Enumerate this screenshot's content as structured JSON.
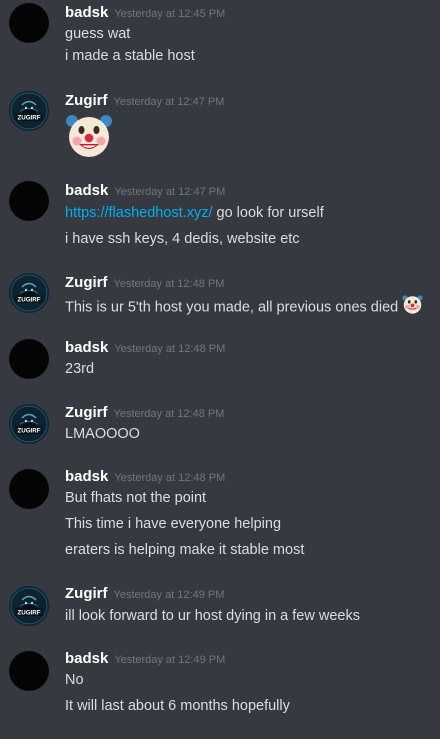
{
  "messages": [
    {
      "author": "badsk",
      "timestamp": "Yesterday at 12:45 PM",
      "lines": [
        "guess wat",
        "i made a stable host"
      ]
    },
    {
      "author": "Zugirf",
      "timestamp": "Yesterday at 12:47 PM",
      "emoji": "clown-face"
    },
    {
      "author": "badsk",
      "timestamp": "Yesterday at 12:47 PM",
      "link": "https://flashedhost.xyz/",
      "link_suffix": " go look for urself",
      "lines": [
        "i have ssh keys, 4 dedis, website etc"
      ]
    },
    {
      "author": "Zugirf",
      "timestamp": "Yesterday at 12:48 PM",
      "lines": [
        "This is ur 5'th host you made, all previous ones died"
      ],
      "inline_emoji": "clown-face"
    },
    {
      "author": "badsk",
      "timestamp": "Yesterday at 12:48 PM",
      "lines": [
        "23rd"
      ]
    },
    {
      "author": "Zugirf",
      "timestamp": "Yesterday at 12:48 PM",
      "lines": [
        "LMAOOOO"
      ]
    },
    {
      "author": "badsk",
      "timestamp": "Yesterday at 12:48 PM",
      "lines": [
        "But fhats not the point",
        "This time i have everyone helping",
        "eraters is helping make it stable most"
      ]
    },
    {
      "author": "Zugirf",
      "timestamp": "Yesterday at 12:49 PM",
      "lines": [
        "ill look forward to ur host dying in a few weeks"
      ]
    },
    {
      "author": "badsk",
      "timestamp": "Yesterday at 12:49 PM",
      "lines": [
        "No",
        "It will last about 6 months hopefully"
      ]
    }
  ],
  "avatar_badge": "ZUGIRF",
  "colors": {
    "background": "#36393f",
    "author": "#ffffff",
    "timestamp": "#72767d",
    "text": "#dcddde",
    "link": "#00aff4"
  }
}
